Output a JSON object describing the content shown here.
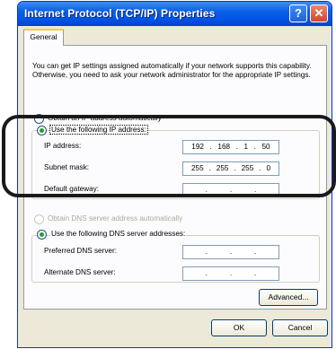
{
  "window": {
    "title": "Internet Protocol (TCP/IP) Properties",
    "help_glyph": "?",
    "close_glyph": "✕"
  },
  "tabs": [
    {
      "label": "General"
    }
  ],
  "description": "You can get IP settings assigned automatically if your network supports this capability. Otherwise, you need to ask your network administrator for the appropriate IP settings.",
  "ip": {
    "auto_label": "Obtain an IP address automatically",
    "manual_label": "Use the following IP address:",
    "fields": [
      {
        "label": "IP address:",
        "octets": [
          "192",
          "168",
          "1",
          "50"
        ]
      },
      {
        "label": "Subnet mask:",
        "octets": [
          "255",
          "255",
          "255",
          "0"
        ]
      },
      {
        "label": "Default gateway:",
        "octets": [
          "",
          "",
          "",
          ""
        ]
      }
    ]
  },
  "dns": {
    "auto_label": "Obtain DNS server address automatically",
    "manual_label": "Use the following DNS server addresses:",
    "fields": [
      {
        "label": "Preferred DNS server:",
        "octets": [
          "",
          "",
          "",
          ""
        ]
      },
      {
        "label": "Alternate DNS server:",
        "octets": [
          "",
          "",
          "",
          ""
        ]
      }
    ]
  },
  "buttons": {
    "advanced": "Advanced...",
    "ok": "OK",
    "cancel": "Cancel"
  },
  "colors": {
    "title_bar": "#0055e5",
    "radio_dot": "#21a121",
    "highlight_border": "#1a1a1a"
  }
}
